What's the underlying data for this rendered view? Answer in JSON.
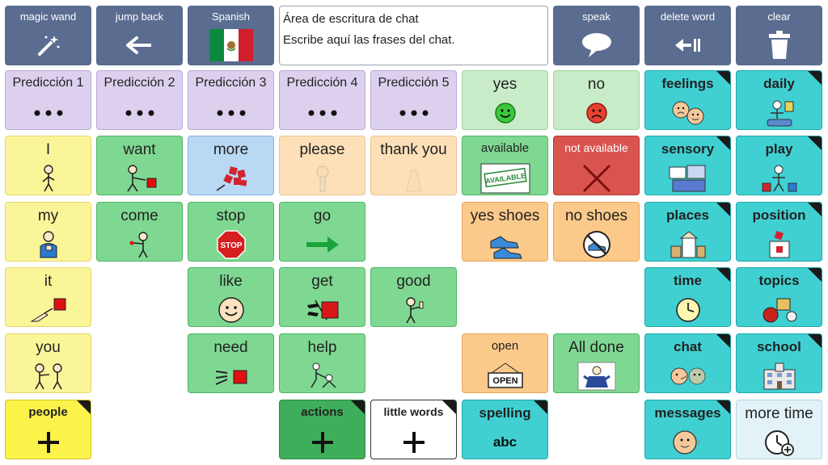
{
  "toolbar": {
    "magic_wand": "magic wand",
    "jump_back": "jump back",
    "language": "Spanish",
    "speak": "speak",
    "delete_word": "delete word",
    "clear": "clear"
  },
  "chat": {
    "title": "Área de escritura de chat",
    "placeholder": "Escribe aquí las frases del chat."
  },
  "predictions": [
    "Predicción 1",
    "Predicción 2",
    "Predicción 3",
    "Predicción 4",
    "Predicción 5"
  ],
  "words": {
    "yes": "yes",
    "no": "no",
    "i": "I",
    "want": "want",
    "more": "more",
    "please": "please",
    "thank_you": "thank you",
    "available": "available",
    "not_available": "not available",
    "my": "my",
    "come": "come",
    "stop": "stop",
    "go": "go",
    "yes_shoes": "yes shoes",
    "no_shoes": "no shoes",
    "it": "it",
    "like": "like",
    "get": "get",
    "good": "good",
    "you": "you",
    "need": "need",
    "help": "help",
    "open": "open",
    "all_done": "All done",
    "people": "people",
    "actions": "actions",
    "little_words": "little words",
    "spelling": "spelling",
    "more_time": "more time"
  },
  "icons": {
    "stop_sign": "STOP",
    "available_sign": "AVAILABLE",
    "open_sign": "OPEN",
    "abc": "abc"
  },
  "categories": {
    "feelings": "feelings",
    "daily": "daily",
    "sensory": "sensory",
    "play": "play",
    "places": "places",
    "position": "position",
    "time": "time",
    "topics": "topics",
    "chat": "chat",
    "school": "school",
    "messages": "messages"
  }
}
